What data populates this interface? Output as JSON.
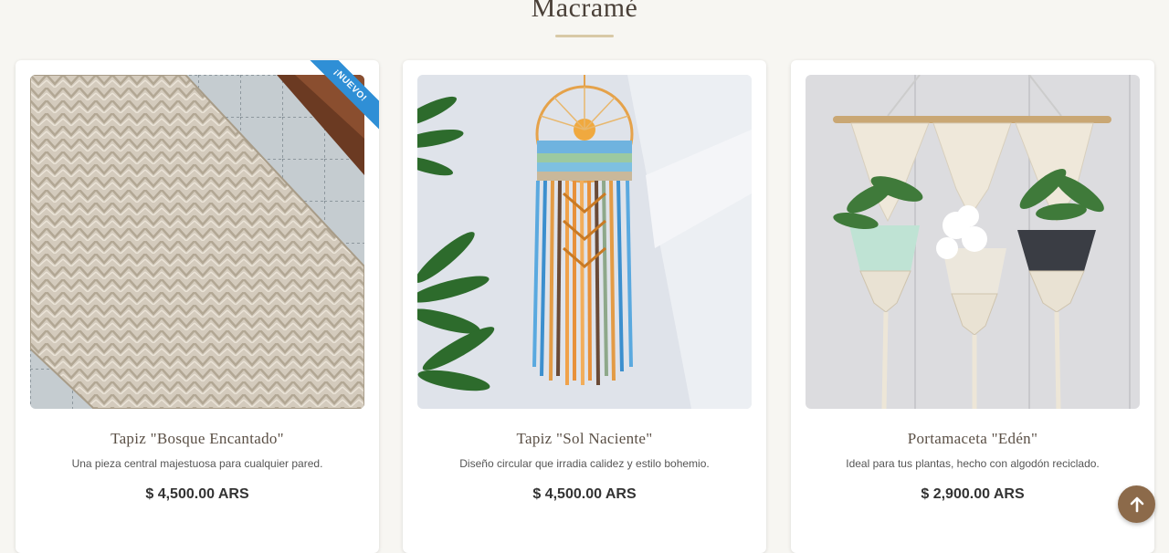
{
  "section": {
    "title": "Macramé"
  },
  "products": [
    {
      "title": "Tapiz \"Bosque Encantado\"",
      "description": "Una pieza central majestuosa para cualquier pared.",
      "price": "$ 4,500.00 ARS",
      "badge": "¡NUEVO!",
      "image_icon": "macrame-table-runner-image"
    },
    {
      "title": "Tapiz \"Sol Naciente\"",
      "description": "Diseño circular que irradia calidez y estilo bohemio.",
      "price": "$ 4,500.00 ARS",
      "image_icon": "macrame-dreamcatcher-image"
    },
    {
      "title": "Portamaceta \"Edén\"",
      "description": "Ideal para tus plantas, hecho con algodón reciclado.",
      "price": "$ 2,900.00 ARS",
      "image_icon": "macrame-plant-hanger-image"
    }
  ],
  "scroll_top": {
    "icon": "arrow-up-icon"
  },
  "colors": {
    "background": "#f7f6f2",
    "badge": "#2f8fd6",
    "scroll_button": "#8c6a4a",
    "underline": "#d8c9a6"
  }
}
